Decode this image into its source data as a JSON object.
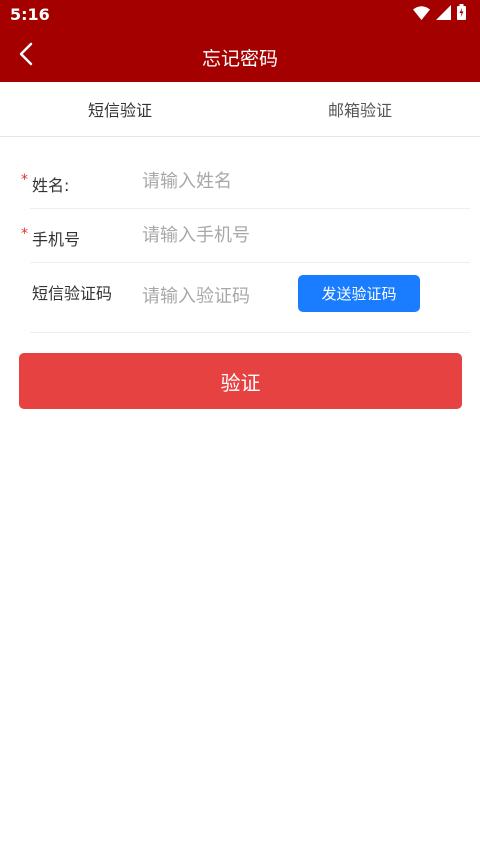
{
  "status_bar": {
    "time": "5:16"
  },
  "app_bar": {
    "title": "忘记密码"
  },
  "tabs": [
    {
      "label": "短信验证"
    },
    {
      "label": "邮箱验证"
    }
  ],
  "form": {
    "name": {
      "label": "姓名:",
      "required_mark": "*",
      "placeholder": "请输入姓名"
    },
    "phone": {
      "label": "手机号",
      "required_mark": "*",
      "placeholder": "请输入手机号"
    },
    "sms_code": {
      "label": "短信验证码",
      "placeholder": "请输入验证码",
      "send_button_label": "发送验证码"
    }
  },
  "verify_button_label": "验证",
  "colors": {
    "header_bg": "#a40000",
    "verify_button": "#e64242",
    "send_button": "#1a7cff",
    "required_mark": "#e03030"
  }
}
